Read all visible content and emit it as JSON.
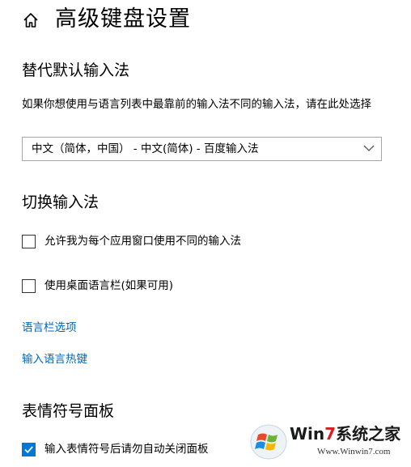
{
  "header": {
    "icon": "home-icon",
    "title": "高级键盘设置"
  },
  "override_input_method": {
    "title": "替代默认输入法",
    "description": "如果你想使用与语言列表中最靠前的输入法不同的输入法，请在此处选择",
    "selected_value": "中文（简体，中国） - 中文(简体) - 百度输入法",
    "dropdown_icon": "chevron-down-icon"
  },
  "switch_input_method": {
    "title": "切换输入法",
    "checkboxes": [
      {
        "label": "允许我为每个应用窗口使用不同的输入法",
        "checked": false
      },
      {
        "label": "使用桌面语言栏(如果可用)",
        "checked": false
      }
    ],
    "links": [
      "语言栏选项",
      "输入语言热键"
    ]
  },
  "emoji_panel": {
    "title": "表情符号面板",
    "checkbox": {
      "label": "输入表情符号后请勿自动关闭面板",
      "checked": true
    }
  },
  "watermark": {
    "title_prefix": "Win",
    "title_number": "7",
    "title_suffix": "系统之家",
    "url": "Www.Winwin7.com"
  },
  "colors": {
    "link": "#0067b8",
    "accent": "#0078d7",
    "text": "#000000",
    "dropdown_border": "#a6a6a6"
  }
}
